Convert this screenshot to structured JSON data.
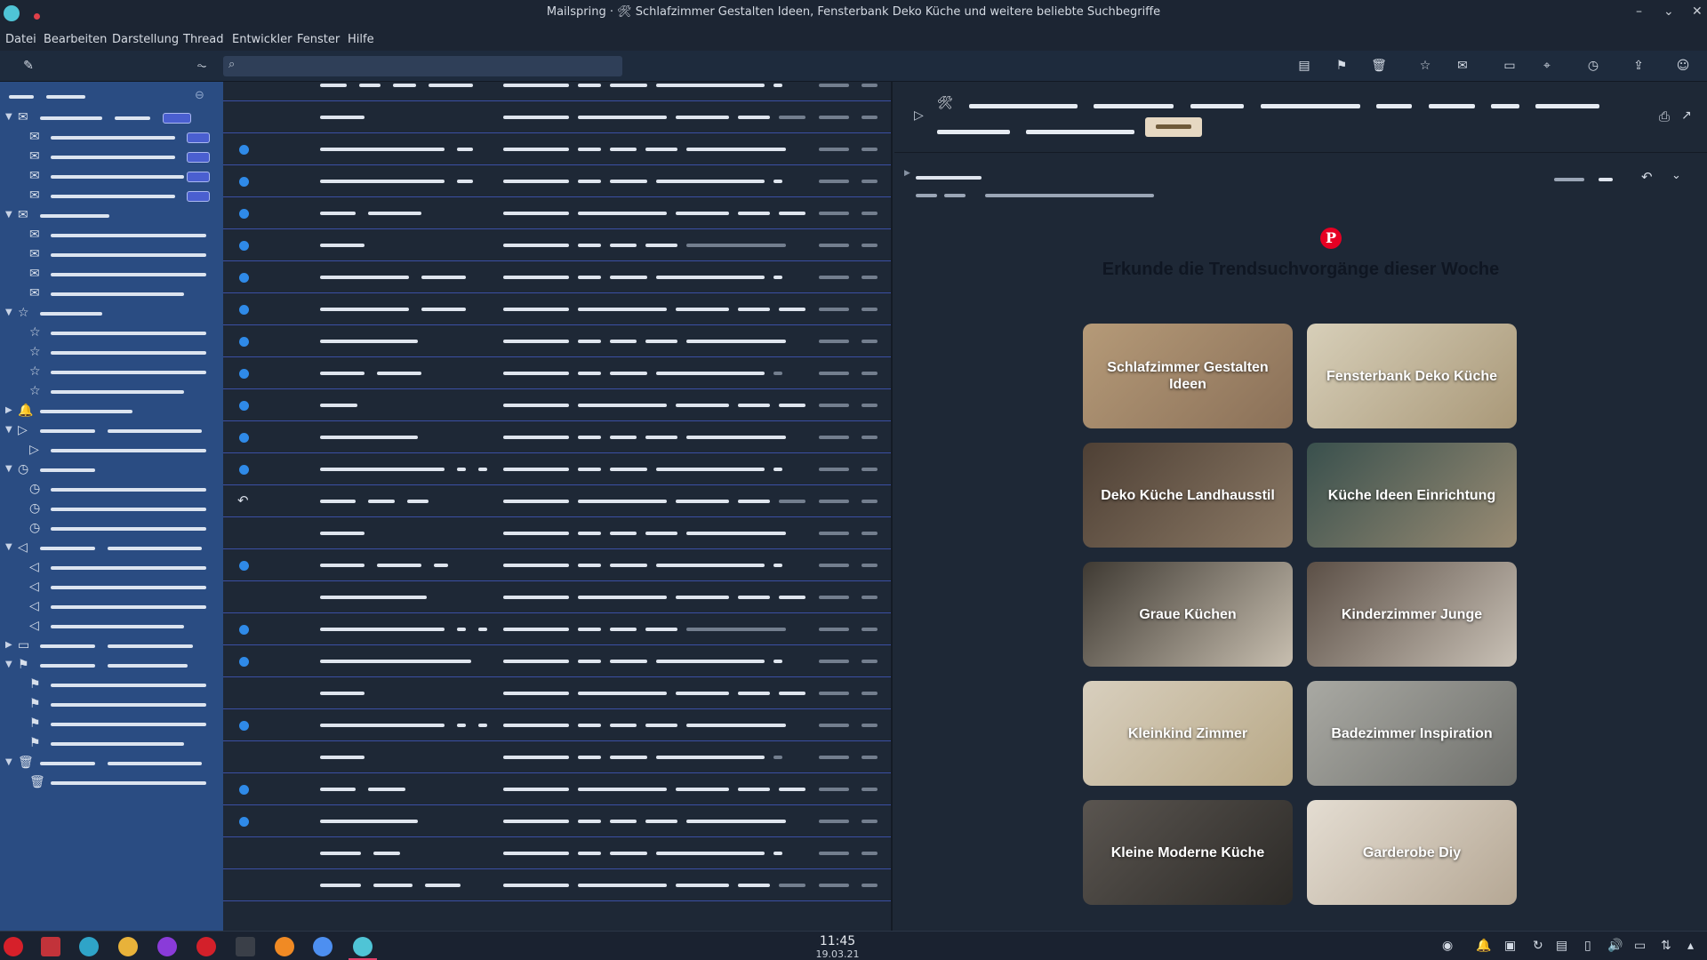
{
  "window": {
    "title": "Mailspring · 🛠 Schlafzimmer Gestalten Ideen, Fensterbank Deko Küche und weitere beliebte Suchbegriffe",
    "minimize": "–",
    "maximize": "⌄",
    "close": "✕"
  },
  "menu": [
    "Datei",
    "Bearbeiten",
    "Darstellung",
    "Thread",
    "Entwickler",
    "Fenster",
    "Hilfe"
  ],
  "search": {
    "placeholder": ""
  },
  "icons": {
    "compose": "✎",
    "activity": "⏦",
    "search": "⌕",
    "archive": "▤",
    "spam": "⚑",
    "trash": "🗑",
    "star": "☆",
    "unread": "✉",
    "move": "▭",
    "label": "⌖",
    "snooze": "◷",
    "share": "⇪",
    "account": "☺",
    "print": "⎙",
    "popout": "↗",
    "reply": "↶",
    "more": "⌄",
    "tool": "🛠"
  },
  "email": {
    "heading": "Erkunde die Trendsuchvorgänge dieser Woche",
    "pinterest_logo": "P",
    "tiles": [
      "Schlafzimmer Gestalten Ideen",
      "Fensterbank Deko Küche",
      "Deko Küche Landhausstil",
      "Küche Ideen Einrichtung",
      "Graue Küchen",
      "Kinderzimmer Junge",
      "Kleinkind Zimmer",
      "Badezimmer Inspiration",
      "Kleine Moderne Küche",
      "Garderobe Diy"
    ]
  },
  "taskbar": {
    "time": "11:45",
    "date": "19.03.21"
  },
  "colors": {
    "sidebar": "#2a4c82",
    "unread_dot": "#2f8ae8",
    "row_divider": "#3b4fa3",
    "pinterest": "#e60023",
    "label_chip": "#e6d8c2"
  }
}
